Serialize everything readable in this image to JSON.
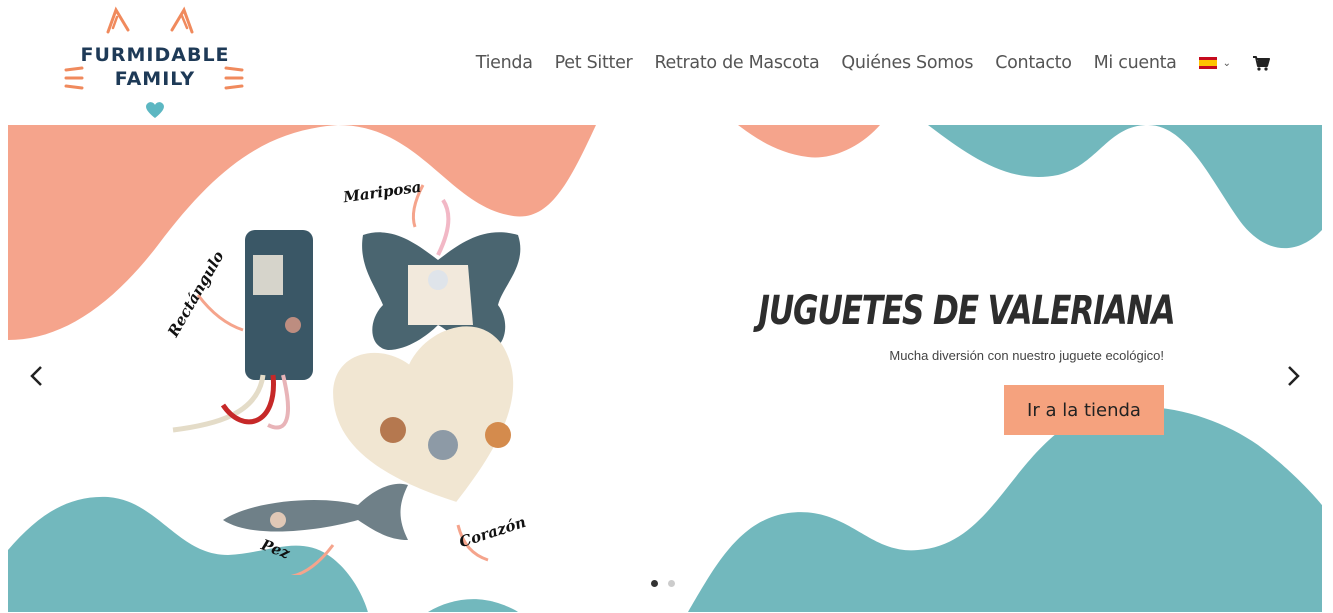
{
  "logo": {
    "line1": "FURMIDABLE",
    "line2": "FAMILY"
  },
  "nav": {
    "items": [
      "Tienda",
      "Pet Sitter",
      "Retrato de Mascota",
      "Quiénes Somos",
      "Contacto",
      "Mi cuenta"
    ],
    "language": "es",
    "cart_icon": "cart-icon"
  },
  "slide": {
    "title": "Juguetes de Valeriana",
    "subtitle": "Mucha diversión con nuestro juguete ecológico!",
    "button": "Ir a la tienda",
    "toy_labels": [
      "Mariposa",
      "Rectángulo",
      "Corazón",
      "Pez"
    ]
  },
  "slider": {
    "slides": 2,
    "active": 1
  },
  "colors": {
    "salmon": "#f5a48c",
    "teal": "#72b8bd",
    "button": "#f5a27e",
    "text_dark": "#2d2d2d",
    "logo_navy": "#1e3a57"
  }
}
